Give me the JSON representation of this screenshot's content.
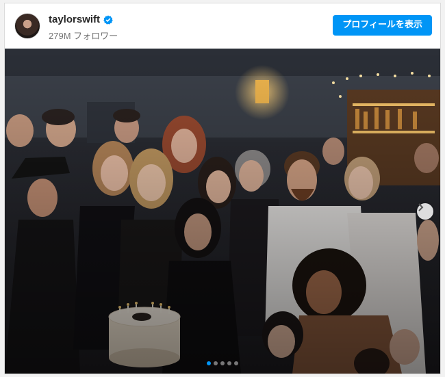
{
  "post": {
    "username": "taylorswift",
    "followers": "279M フォロワー",
    "view_profile_label": "プロフィールを表示",
    "verified_icon": "verified-badge-icon",
    "carousel": {
      "total_slides": 5,
      "current_slide": 1,
      "next_icon": "chevron-right-icon"
    }
  },
  "colors": {
    "brand_blue": "#0095f6",
    "text_primary": "#262626",
    "text_secondary": "#737373"
  }
}
